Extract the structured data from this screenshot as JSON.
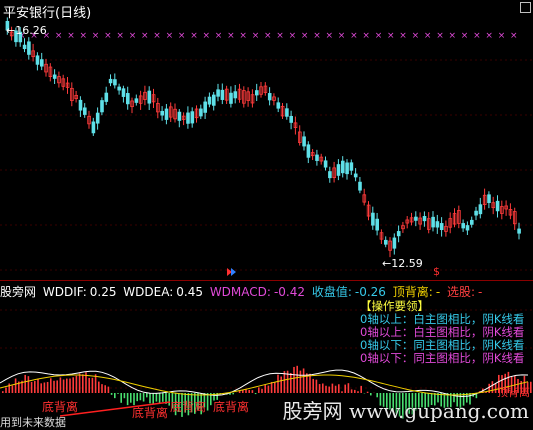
{
  "window": {
    "title": "平安银行(日线)"
  },
  "main_chart": {
    "high_label": "16.26",
    "low_label": "12.59",
    "marker_symbol": "$",
    "up_color": "#ff3b3b",
    "down_color": "#5fe0e8",
    "signal_color": "#e04ad8"
  },
  "indicator": {
    "name": "股旁网",
    "wddif_label": "WDDIF:",
    "wddif_value": "0.25",
    "wddea_label": "WDDEA:",
    "wddea_value": "0.45",
    "wdmacd_label": "WDMACD:",
    "wdmacd_value": "-0.42",
    "close_label": "收盘值:",
    "close_value": "-0.26",
    "top_div_label": "顶背离:",
    "top_div_value": "-",
    "pick_label": "选股:",
    "pick_value": "-"
  },
  "guide": {
    "title": "【操作要领】",
    "lines": [
      {
        "text": "0轴以上：白主图相比，阴K线看",
        "color": "#36c8e8"
      },
      {
        "text": "0轴以上：白主图相比，阴K线看",
        "color": "#e04ad8"
      },
      {
        "text": "0轴以下：同主图相比，阴K线看",
        "color": "#36c8e8"
      },
      {
        "text": "0轴以下：同主图相比，阴K线看",
        "color": "#e04ad8"
      }
    ]
  },
  "divergence_tags": [
    "底背离",
    "底背离",
    "底背离",
    "底背离",
    "顶背离"
  ],
  "watermark": "股旁网 www.gupang.com",
  "footer_note": "用到未来数据"
}
